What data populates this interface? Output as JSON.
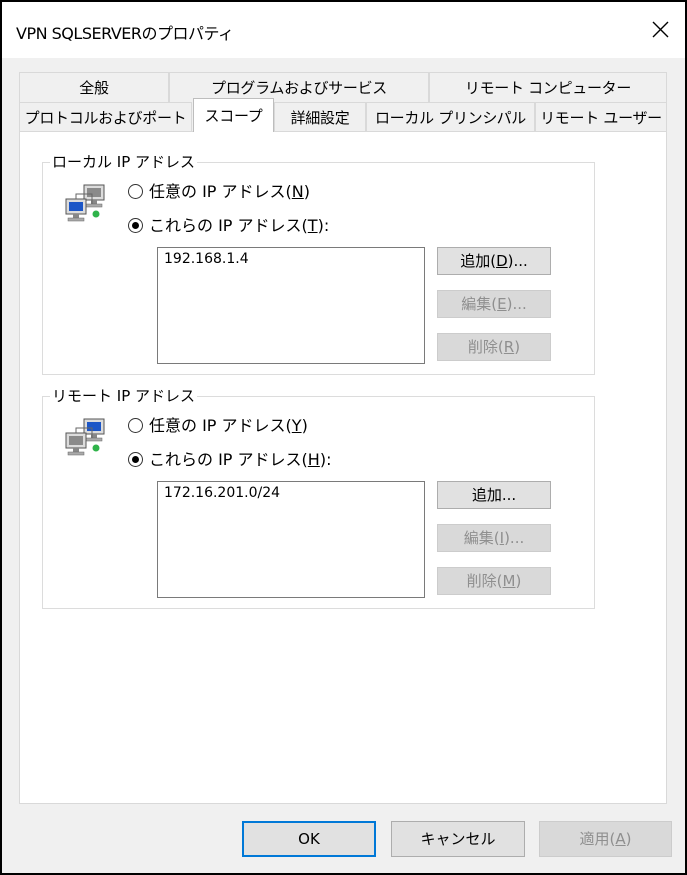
{
  "window": {
    "title": "VPN SQLSERVERのプロパティ"
  },
  "tabs": {
    "row1": [
      "全般",
      "プログラムおよびサービス",
      "リモート コンピューター"
    ],
    "row2": [
      "プロトコルおよびポート",
      "スコープ",
      "詳細設定",
      "ローカル プリンシパル",
      "リモート ユーザー"
    ],
    "active": "スコープ"
  },
  "local": {
    "legend": "ローカル IP アドレス",
    "any_label": "任意の IP アドレス",
    "any_key": "N",
    "these_label": "これらの IP アドレス",
    "these_key": "T",
    "selected": "these",
    "addresses": [
      "192.168.1.4"
    ],
    "add_label": "追加",
    "add_key": "D",
    "edit_label": "編集",
    "edit_key": "E",
    "remove_label": "削除",
    "remove_key": "R"
  },
  "remote": {
    "legend": "リモート IP アドレス",
    "any_label": "任意の IP アドレス",
    "any_key": "Y",
    "these_label": "これらの IP アドレス",
    "these_key": "H",
    "selected": "these",
    "addresses": [
      "172.16.201.0/24"
    ],
    "add_label": "追加...",
    "edit_label": "編集",
    "edit_key": "I",
    "remove_label": "削除",
    "remove_key": "M"
  },
  "footer": {
    "ok": "OK",
    "cancel": "キャンセル",
    "apply": "適用",
    "apply_key": "A"
  },
  "icons": {
    "close": "close-icon",
    "network": "network-computers-icon"
  }
}
